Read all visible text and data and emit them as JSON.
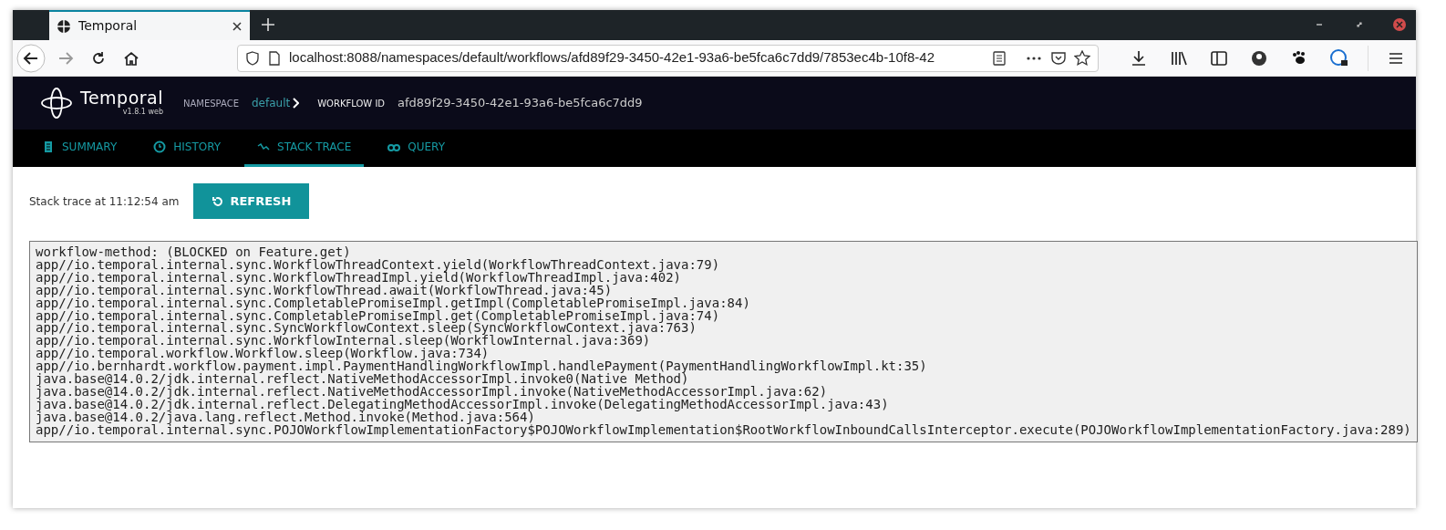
{
  "browser": {
    "tab": {
      "title": "Temporal",
      "selected": true
    },
    "url": "localhost:8088/namespaces/default/workflows/afd89f29-3450-42e1-93a6-be5fca6c7dd9/7853ec4b-10f8-42"
  },
  "header": {
    "logo": "Temporal",
    "version": "v1.8.1 web",
    "namespace_label": "NAMESPACE",
    "namespace": "default",
    "workflow_id_label": "WORKFLOW ID",
    "workflow_id": "afd89f29-3450-42e1-93a6-be5fca6c7dd9"
  },
  "tabs": [
    {
      "label": "SUMMARY",
      "kind": "summary",
      "selected": false
    },
    {
      "label": "HISTORY",
      "kind": "history",
      "selected": false
    },
    {
      "label": "STACK TRACE",
      "kind": "trace",
      "selected": true
    },
    {
      "label": "QUERY",
      "kind": "query",
      "selected": false
    }
  ],
  "toolbar": {
    "timestamp": "Stack trace at 11:12:54 am",
    "button": "REFRESH"
  },
  "stack_trace": [
    "workflow-method: (BLOCKED on Feature.get)",
    "app//io.temporal.internal.sync.WorkflowThreadContext.yield(WorkflowThreadContext.java:79)",
    "app//io.temporal.internal.sync.WorkflowThreadImpl.yield(WorkflowThreadImpl.java:402)",
    "app//io.temporal.internal.sync.WorkflowThread.await(WorkflowThread.java:45)",
    "app//io.temporal.internal.sync.CompletablePromiseImpl.getImpl(CompletablePromiseImpl.java:84)",
    "app//io.temporal.internal.sync.CompletablePromiseImpl.get(CompletablePromiseImpl.java:74)",
    "app//io.temporal.internal.sync.SyncWorkflowContext.sleep(SyncWorkflowContext.java:763)",
    "app//io.temporal.internal.sync.WorkflowInternal.sleep(WorkflowInternal.java:369)",
    "app//io.temporal.workflow.Workflow.sleep(Workflow.java:734)",
    "app//io.bernhardt.workflow.payment.impl.PaymentHandlingWorkflowImpl.handlePayment(PaymentHandlingWorkflowImpl.kt:35)",
    "java.base@14.0.2/jdk.internal.reflect.NativeMethodAccessorImpl.invoke0(Native Method)",
    "java.base@14.0.2/jdk.internal.reflect.NativeMethodAccessorImpl.invoke(NativeMethodAccessorImpl.java:62)",
    "java.base@14.0.2/jdk.internal.reflect.DelegatingMethodAccessorImpl.invoke(DelegatingMethodAccessorImpl.java:43)",
    "java.base@14.0.2/java.lang.reflect.Method.invoke(Method.java:564)",
    "app//io.temporal.internal.sync.POJOWorkflowImplementationFactory$POJOWorkflowImplementation$RootWorkflowInboundCallsInterceptor.execute(POJOWorkflowImplementationFactory.java:289)"
  ]
}
